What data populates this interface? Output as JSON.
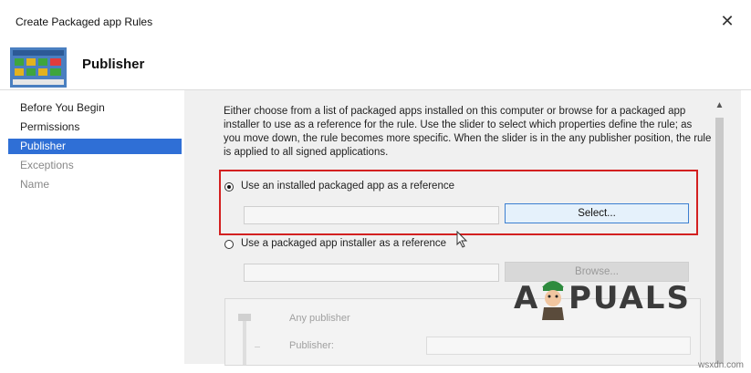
{
  "window": {
    "title": "Create Packaged app Rules",
    "close_icon": "close-icon"
  },
  "header": {
    "heading": "Publisher",
    "icon": "packaged-app-icon"
  },
  "nav": {
    "items": [
      {
        "label": "Before You Begin",
        "state": "normal"
      },
      {
        "label": "Permissions",
        "state": "normal"
      },
      {
        "label": "Publisher",
        "state": "active"
      },
      {
        "label": "Exceptions",
        "state": "disabled"
      },
      {
        "label": "Name",
        "state": "disabled"
      }
    ]
  },
  "content": {
    "description": "Either choose from a list of packaged apps installed on this computer or browse for a packaged app installer to use as a reference for the rule. Use the slider to select which properties define the rule; as you move down, the rule becomes more specific. When the slider is in the any publisher position, the rule is applied to all signed applications.",
    "option_installed": {
      "label": "Use an installed packaged app as a reference",
      "selected": true,
      "value": ""
    },
    "select_button": "Select...",
    "option_installer": {
      "label": "Use a packaged app installer as a reference",
      "selected": false,
      "value": ""
    },
    "browse_button": "Browse...",
    "slider": {
      "any_publisher": "Any publisher",
      "publisher_label": "Publisher:",
      "publisher_value": ""
    }
  },
  "watermark": {
    "text_a": "A",
    "text_puals": "PUALS"
  },
  "source": "wsxdn.com",
  "colors": {
    "accent": "#2f6fd6",
    "highlight": "#d32020"
  }
}
